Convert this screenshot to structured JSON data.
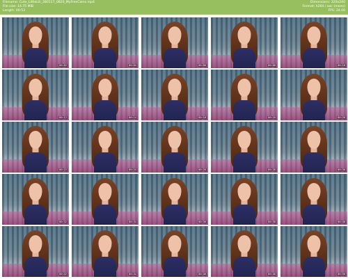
{
  "header": {
    "filename_line": "Filename: Cute_LittleLili_280117_0820_MyFreeCams.mp4",
    "filesize_line": "File size: 14.75 MiB",
    "length_line": "Length: 00:53",
    "dimensions_line": "Dimensions: 320x240",
    "format_line": "Format: h264 / aac (mono)",
    "fps_line": "FPS: 24.00",
    "bg_color": "#97bf60"
  },
  "thumbnails": [
    {
      "timestamp": "00:02"
    },
    {
      "timestamp": "00:04"
    },
    {
      "timestamp": "00:06"
    },
    {
      "timestamp": "00:08"
    },
    {
      "timestamp": "00:10"
    },
    {
      "timestamp": "00:12"
    },
    {
      "timestamp": "00:14"
    },
    {
      "timestamp": "00:16"
    },
    {
      "timestamp": "00:18"
    },
    {
      "timestamp": "00:20"
    },
    {
      "timestamp": "00:22"
    },
    {
      "timestamp": "00:24"
    },
    {
      "timestamp": "00:26"
    },
    {
      "timestamp": "00:28"
    },
    {
      "timestamp": "00:30"
    },
    {
      "timestamp": "00:32"
    },
    {
      "timestamp": "00:34"
    },
    {
      "timestamp": "00:36"
    },
    {
      "timestamp": "00:38"
    },
    {
      "timestamp": "00:40"
    },
    {
      "timestamp": "00:42"
    },
    {
      "timestamp": "00:44"
    },
    {
      "timestamp": "00:46"
    },
    {
      "timestamp": "00:48"
    },
    {
      "timestamp": "00:50"
    }
  ]
}
